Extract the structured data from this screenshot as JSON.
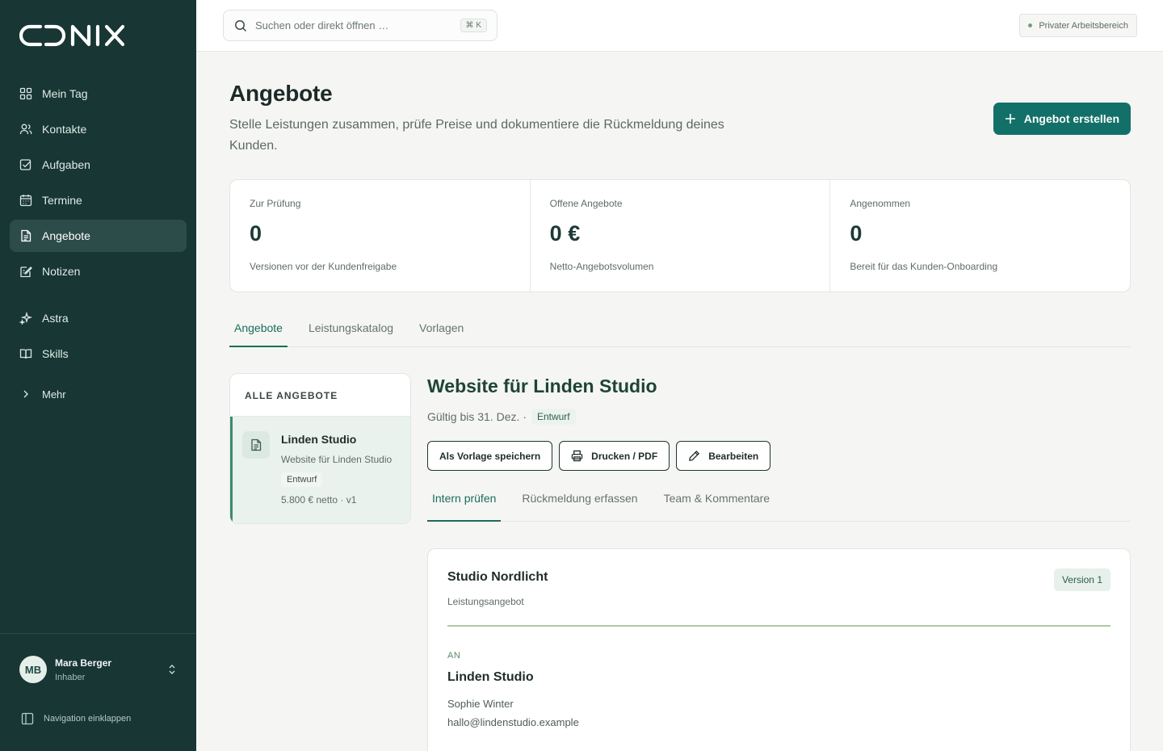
{
  "sidebar": {
    "logo_text": "CONIX",
    "items": [
      {
        "label": "Mein Tag",
        "icon": "dashboard-icon"
      },
      {
        "label": "Kontakte",
        "icon": "contacts-icon"
      },
      {
        "label": "Aufgaben",
        "icon": "tasks-icon"
      },
      {
        "label": "Termine",
        "icon": "calendar-icon"
      },
      {
        "label": "Angebote",
        "icon": "document-icon",
        "active": true
      },
      {
        "label": "Notizen",
        "icon": "notes-icon"
      },
      {
        "label": "Astra",
        "icon": "sparkle-icon"
      },
      {
        "label": "Skills",
        "icon": "book-icon"
      }
    ],
    "more_label": "Mehr",
    "user": {
      "initials": "MB",
      "name": "Mara Berger",
      "role": "Inhaber"
    },
    "collapse_label": "Navigation einklappen"
  },
  "topbar": {
    "search_placeholder": "Suchen oder direkt öffnen …",
    "search_shortcut": "⌘ K",
    "workspace": "Privater Arbeitsbereich"
  },
  "page": {
    "title": "Angebote",
    "subtitle": "Stelle Leistungen zusammen, prüfe Preise und dokumentiere die Rückmeldung deines Kunden.",
    "create_button": "Angebot erstellen"
  },
  "stats": [
    {
      "label": "Zur Prüfung",
      "value": "0",
      "note": "Versionen vor der Kundenfreigabe"
    },
    {
      "label": "Offene Angebote",
      "value": "0 €",
      "note": "Netto-Angebotsvolumen"
    },
    {
      "label": "Angenommen",
      "value": "0",
      "note": "Bereit für das Kunden-Onboarding"
    }
  ],
  "tabs": [
    "Angebote",
    "Leistungskatalog",
    "Vorlagen"
  ],
  "list": {
    "header": "ALLE ANGEBOTE",
    "items": [
      {
        "title": "Linden Studio",
        "subtitle": "Website für Linden Studio",
        "status": "Entwurf",
        "meta": "5.800 € netto · v1"
      }
    ]
  },
  "detail": {
    "title": "Website für Linden Studio",
    "valid": "Gültig bis 31. Dez. ·",
    "status": "Entwurf",
    "actions": {
      "template": "Als Vorlage speichern",
      "print": "Drucken / PDF",
      "edit": "Bearbeiten"
    },
    "subtabs": [
      "Intern prüfen",
      "Rückmeldung erfassen",
      "Team & Kommentare"
    ],
    "card": {
      "company": "Studio Nordlicht",
      "doc_type": "Leistungsangebot",
      "version": "Version 1",
      "to_label": "AN",
      "recipient": "Linden Studio",
      "contact": "Sophie Winter",
      "email": "hallo@lindenstudio.example"
    }
  },
  "colors": {
    "sidebar_bg": "#173634",
    "sidebar_active": "#2c4c49",
    "accent": "#137068",
    "tab_active": "#1a6c59"
  }
}
